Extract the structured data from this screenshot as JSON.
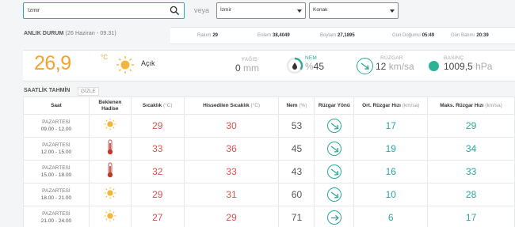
{
  "search": {
    "value": "İzmir"
  },
  "or_label": "veya",
  "city_select": {
    "selected": "İzmir"
  },
  "district_select": {
    "selected": "Konak"
  },
  "current_status": {
    "title": "ANLIK DURUM",
    "date": "(26 Haziran - 09.31)",
    "rakim_label": "Rakım",
    "rakim": "29",
    "enlem_label": "Enlem",
    "enlem": "38,4049",
    "boylam_label": "Boylam",
    "boylam": "27,1895",
    "sunrise_label": "Gün Doğumu",
    "sunrise": "05:49",
    "sunset_label": "Gün Batımı",
    "sunset": "20:39"
  },
  "current": {
    "temperature": "26,9",
    "unit": "°C",
    "condition": "Açık",
    "icon": "sun-icon",
    "rain_label": "YAĞIŞ",
    "rain_value": "0",
    "rain_unit": "mm",
    "humidity_label": "NEM",
    "humidity_prefix": "%",
    "humidity_value": "45",
    "wind_label": "RÜZGAR",
    "wind_value": "12",
    "wind_unit": "km/sa",
    "pressure_label": "BASINÇ",
    "pressure_value": "1009,5",
    "pressure_unit": "hPa"
  },
  "hourly": {
    "title": "SAATLİK TAHMİN",
    "hide_label": "GİZLE",
    "headers": {
      "time": "Saat",
      "event_line1": "Beklenen",
      "event_line2": "Hadise",
      "temp": "Sıcaklık",
      "temp_unit": "(°C)",
      "feels": "Hissedilen Sıcaklık",
      "feels_unit": "(°C)",
      "humidity": "Nem",
      "humidity_unit": "(%)",
      "wind_dir": "Rüzgar Yönü",
      "avg_wind": "Ort. Rüzgar Hızı",
      "avg_wind_unit": "(km/sa)",
      "max_wind": "Maks. Rüzgar Hızı",
      "max_wind_unit": "(km/sa)"
    },
    "rows": [
      {
        "day": "PAZARTESİ",
        "time": "09.00 - 12.00",
        "event": "sun-icon",
        "temp": "29",
        "feels": "30",
        "humidity": "53",
        "wind_dir": "southeast-arrow",
        "avg_wind": "17",
        "max_wind": "29"
      },
      {
        "day": "PAZARTESİ",
        "time": "12.00 - 15.00",
        "event": "thermometer-icon",
        "temp": "33",
        "feels": "36",
        "humidity": "45",
        "wind_dir": "southeast-arrow",
        "avg_wind": "19",
        "max_wind": "34"
      },
      {
        "day": "PAZARTESİ",
        "time": "15.00 - 18.00",
        "event": "thermometer-icon",
        "temp": "32",
        "feels": "33",
        "humidity": "43",
        "wind_dir": "southeast-arrow",
        "avg_wind": "16",
        "max_wind": "33"
      },
      {
        "day": "PAZARTESİ",
        "time": "18.00 - 21.00",
        "event": "sun-icon",
        "temp": "29",
        "feels": "31",
        "humidity": "60",
        "wind_dir": "southeast-arrow",
        "avg_wind": "10",
        "max_wind": "28"
      },
      {
        "day": "PAZARTESİ",
        "time": "21.00 - 24.00",
        "event": "sun-icon",
        "temp": "27",
        "feels": "29",
        "humidity": "71",
        "wind_dir": "east-arrow",
        "avg_wind": "6",
        "max_wind": "17"
      }
    ]
  },
  "colors": {
    "accent": "#2aa7b4",
    "temp": "#f4a22a",
    "hot": "#d9534f",
    "wind": "#2aa89a"
  }
}
